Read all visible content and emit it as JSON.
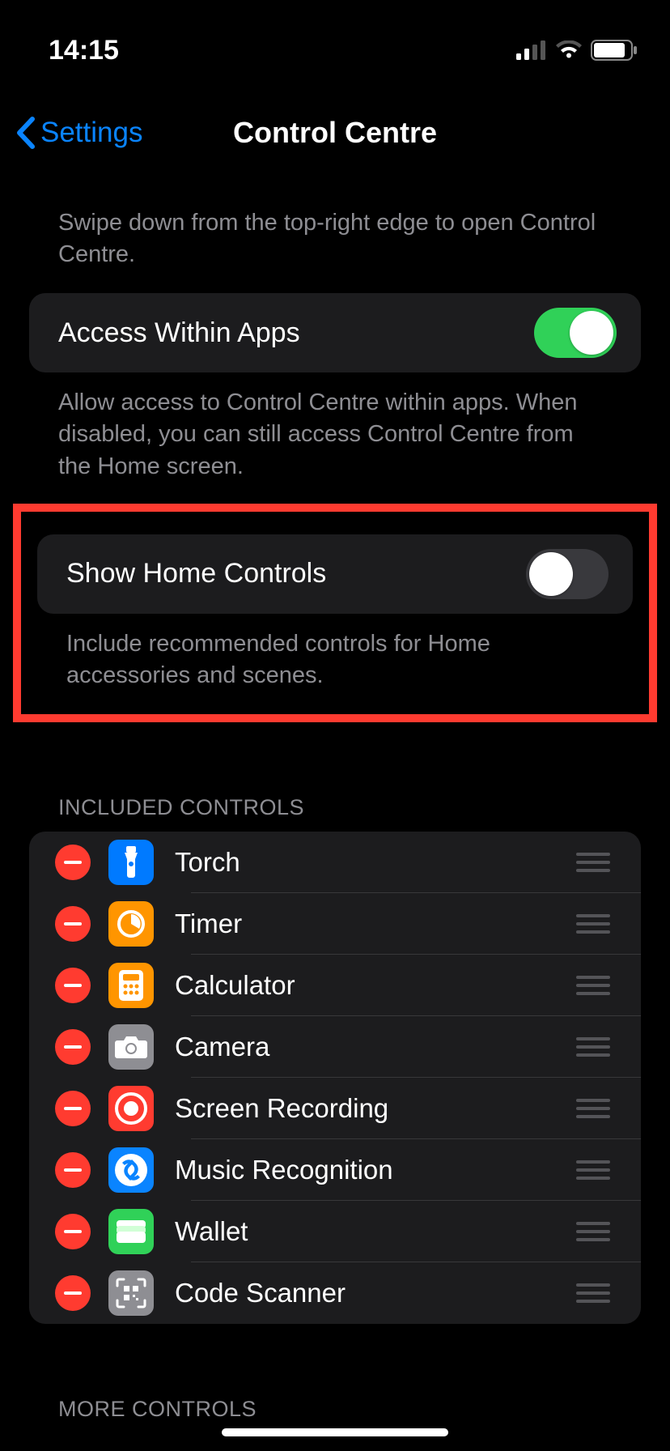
{
  "status": {
    "time": "14:15"
  },
  "nav": {
    "back_label": "Settings",
    "title": "Control Centre"
  },
  "intro": "Swipe down from the top-right edge to open Control Centre.",
  "access": {
    "label": "Access Within Apps",
    "on": true,
    "footer": "Allow access to Control Centre within apps. When disabled, you can still access Control Centre from the Home screen."
  },
  "home": {
    "label": "Show Home Controls",
    "on": false,
    "footer": "Include recommended controls for Home accessories and scenes."
  },
  "included": {
    "header": "INCLUDED CONTROLS",
    "items": [
      {
        "label": "Torch",
        "icon": "torch",
        "color": "ic-blue"
      },
      {
        "label": "Timer",
        "icon": "timer",
        "color": "ic-orange"
      },
      {
        "label": "Calculator",
        "icon": "calculator",
        "color": "ic-orange"
      },
      {
        "label": "Camera",
        "icon": "camera",
        "color": "ic-gray"
      },
      {
        "label": "Screen Recording",
        "icon": "screen-recording",
        "color": "ic-red"
      },
      {
        "label": "Music Recognition",
        "icon": "shazam",
        "color": "ic-shazam"
      },
      {
        "label": "Wallet",
        "icon": "wallet",
        "color": "ic-green"
      },
      {
        "label": "Code Scanner",
        "icon": "code-scanner",
        "color": "ic-gray"
      }
    ]
  },
  "more": {
    "header": "MORE CONTROLS"
  }
}
